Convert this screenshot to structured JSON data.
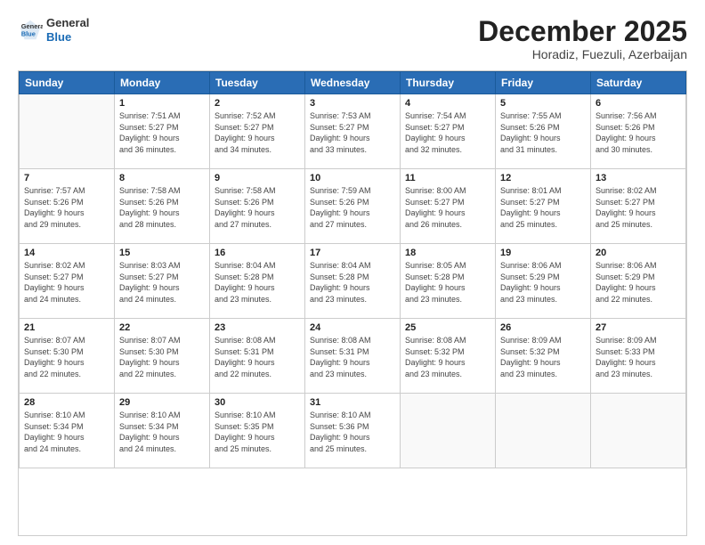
{
  "logo": {
    "line1": "General",
    "line2": "Blue"
  },
  "header": {
    "month": "December 2025",
    "location": "Horadiz, Fuezuli, Azerbaijan"
  },
  "weekdays": [
    "Sunday",
    "Monday",
    "Tuesday",
    "Wednesday",
    "Thursday",
    "Friday",
    "Saturday"
  ],
  "weeks": [
    [
      {
        "day": "",
        "info": ""
      },
      {
        "day": "1",
        "info": "Sunrise: 7:51 AM\nSunset: 5:27 PM\nDaylight: 9 hours\nand 36 minutes."
      },
      {
        "day": "2",
        "info": "Sunrise: 7:52 AM\nSunset: 5:27 PM\nDaylight: 9 hours\nand 34 minutes."
      },
      {
        "day": "3",
        "info": "Sunrise: 7:53 AM\nSunset: 5:27 PM\nDaylight: 9 hours\nand 33 minutes."
      },
      {
        "day": "4",
        "info": "Sunrise: 7:54 AM\nSunset: 5:27 PM\nDaylight: 9 hours\nand 32 minutes."
      },
      {
        "day": "5",
        "info": "Sunrise: 7:55 AM\nSunset: 5:26 PM\nDaylight: 9 hours\nand 31 minutes."
      },
      {
        "day": "6",
        "info": "Sunrise: 7:56 AM\nSunset: 5:26 PM\nDaylight: 9 hours\nand 30 minutes."
      }
    ],
    [
      {
        "day": "7",
        "info": "Sunrise: 7:57 AM\nSunset: 5:26 PM\nDaylight: 9 hours\nand 29 minutes."
      },
      {
        "day": "8",
        "info": "Sunrise: 7:58 AM\nSunset: 5:26 PM\nDaylight: 9 hours\nand 28 minutes."
      },
      {
        "day": "9",
        "info": "Sunrise: 7:58 AM\nSunset: 5:26 PM\nDaylight: 9 hours\nand 27 minutes."
      },
      {
        "day": "10",
        "info": "Sunrise: 7:59 AM\nSunset: 5:26 PM\nDaylight: 9 hours\nand 27 minutes."
      },
      {
        "day": "11",
        "info": "Sunrise: 8:00 AM\nSunset: 5:27 PM\nDaylight: 9 hours\nand 26 minutes."
      },
      {
        "day": "12",
        "info": "Sunrise: 8:01 AM\nSunset: 5:27 PM\nDaylight: 9 hours\nand 25 minutes."
      },
      {
        "day": "13",
        "info": "Sunrise: 8:02 AM\nSunset: 5:27 PM\nDaylight: 9 hours\nand 25 minutes."
      }
    ],
    [
      {
        "day": "14",
        "info": "Sunrise: 8:02 AM\nSunset: 5:27 PM\nDaylight: 9 hours\nand 24 minutes."
      },
      {
        "day": "15",
        "info": "Sunrise: 8:03 AM\nSunset: 5:27 PM\nDaylight: 9 hours\nand 24 minutes."
      },
      {
        "day": "16",
        "info": "Sunrise: 8:04 AM\nSunset: 5:28 PM\nDaylight: 9 hours\nand 23 minutes."
      },
      {
        "day": "17",
        "info": "Sunrise: 8:04 AM\nSunset: 5:28 PM\nDaylight: 9 hours\nand 23 minutes."
      },
      {
        "day": "18",
        "info": "Sunrise: 8:05 AM\nSunset: 5:28 PM\nDaylight: 9 hours\nand 23 minutes."
      },
      {
        "day": "19",
        "info": "Sunrise: 8:06 AM\nSunset: 5:29 PM\nDaylight: 9 hours\nand 23 minutes."
      },
      {
        "day": "20",
        "info": "Sunrise: 8:06 AM\nSunset: 5:29 PM\nDaylight: 9 hours\nand 22 minutes."
      }
    ],
    [
      {
        "day": "21",
        "info": "Sunrise: 8:07 AM\nSunset: 5:30 PM\nDaylight: 9 hours\nand 22 minutes."
      },
      {
        "day": "22",
        "info": "Sunrise: 8:07 AM\nSunset: 5:30 PM\nDaylight: 9 hours\nand 22 minutes."
      },
      {
        "day": "23",
        "info": "Sunrise: 8:08 AM\nSunset: 5:31 PM\nDaylight: 9 hours\nand 22 minutes."
      },
      {
        "day": "24",
        "info": "Sunrise: 8:08 AM\nSunset: 5:31 PM\nDaylight: 9 hours\nand 23 minutes."
      },
      {
        "day": "25",
        "info": "Sunrise: 8:08 AM\nSunset: 5:32 PM\nDaylight: 9 hours\nand 23 minutes."
      },
      {
        "day": "26",
        "info": "Sunrise: 8:09 AM\nSunset: 5:32 PM\nDaylight: 9 hours\nand 23 minutes."
      },
      {
        "day": "27",
        "info": "Sunrise: 8:09 AM\nSunset: 5:33 PM\nDaylight: 9 hours\nand 23 minutes."
      }
    ],
    [
      {
        "day": "28",
        "info": "Sunrise: 8:10 AM\nSunset: 5:34 PM\nDaylight: 9 hours\nand 24 minutes."
      },
      {
        "day": "29",
        "info": "Sunrise: 8:10 AM\nSunset: 5:34 PM\nDaylight: 9 hours\nand 24 minutes."
      },
      {
        "day": "30",
        "info": "Sunrise: 8:10 AM\nSunset: 5:35 PM\nDaylight: 9 hours\nand 25 minutes."
      },
      {
        "day": "31",
        "info": "Sunrise: 8:10 AM\nSunset: 5:36 PM\nDaylight: 9 hours\nand 25 minutes."
      },
      {
        "day": "",
        "info": ""
      },
      {
        "day": "",
        "info": ""
      },
      {
        "day": "",
        "info": ""
      }
    ]
  ]
}
